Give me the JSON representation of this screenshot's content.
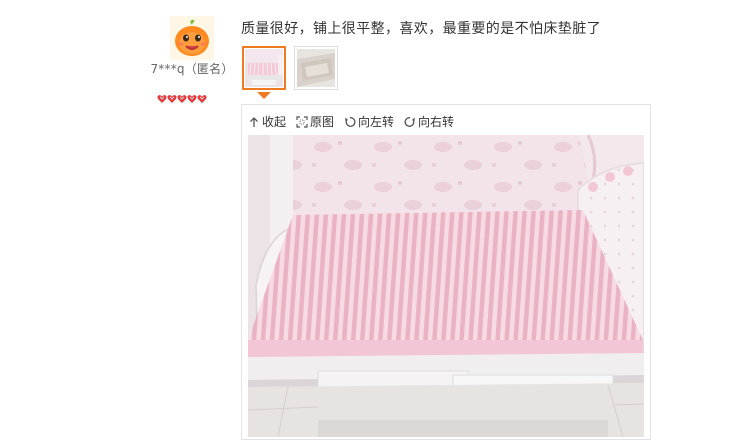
{
  "user": {
    "name": "7***q（匿名）",
    "avatar": "orange-mascot-avatar",
    "level_hearts": 5,
    "heart_color": "#e4393c"
  },
  "review": {
    "text": "质量很好，铺上很平整，喜欢，最重要的是不怕床垫脏了"
  },
  "thumbnails": [
    {
      "name": "bed-photo-thumbnail-1",
      "selected": true
    },
    {
      "name": "bed-photo-thumbnail-2",
      "selected": false
    }
  ],
  "toolbar": {
    "collapse_label": "收起",
    "original_label": "原图",
    "rotate_left_label": "向左转",
    "rotate_right_label": "向右转"
  },
  "colors": {
    "accent": "#ee7a23",
    "text": "#333333",
    "border": "#e3e3e3"
  },
  "photo": {
    "subject": "bed-with-pink-striped-fitted-sheet"
  }
}
